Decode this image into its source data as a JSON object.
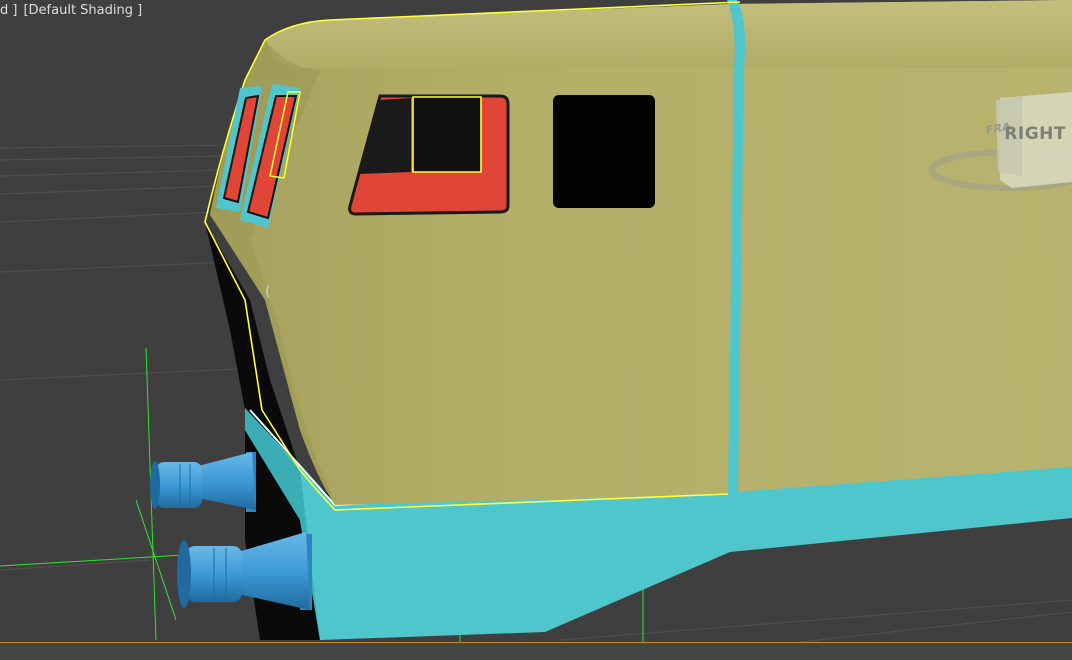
{
  "viewport": {
    "label_view": "d ]",
    "label_shading": "[Default Shading ]"
  },
  "viewcube": {
    "face_label": "RIGHT",
    "side_label": "FRA"
  },
  "colors": {
    "background": "#3f3f3f",
    "body": "#b5b06a",
    "frame": "#4ec6cc",
    "window_red": "#e04535",
    "selection": "#ffff40",
    "gizmo": "#2ee62e",
    "buffer": "#3d9bd6"
  }
}
